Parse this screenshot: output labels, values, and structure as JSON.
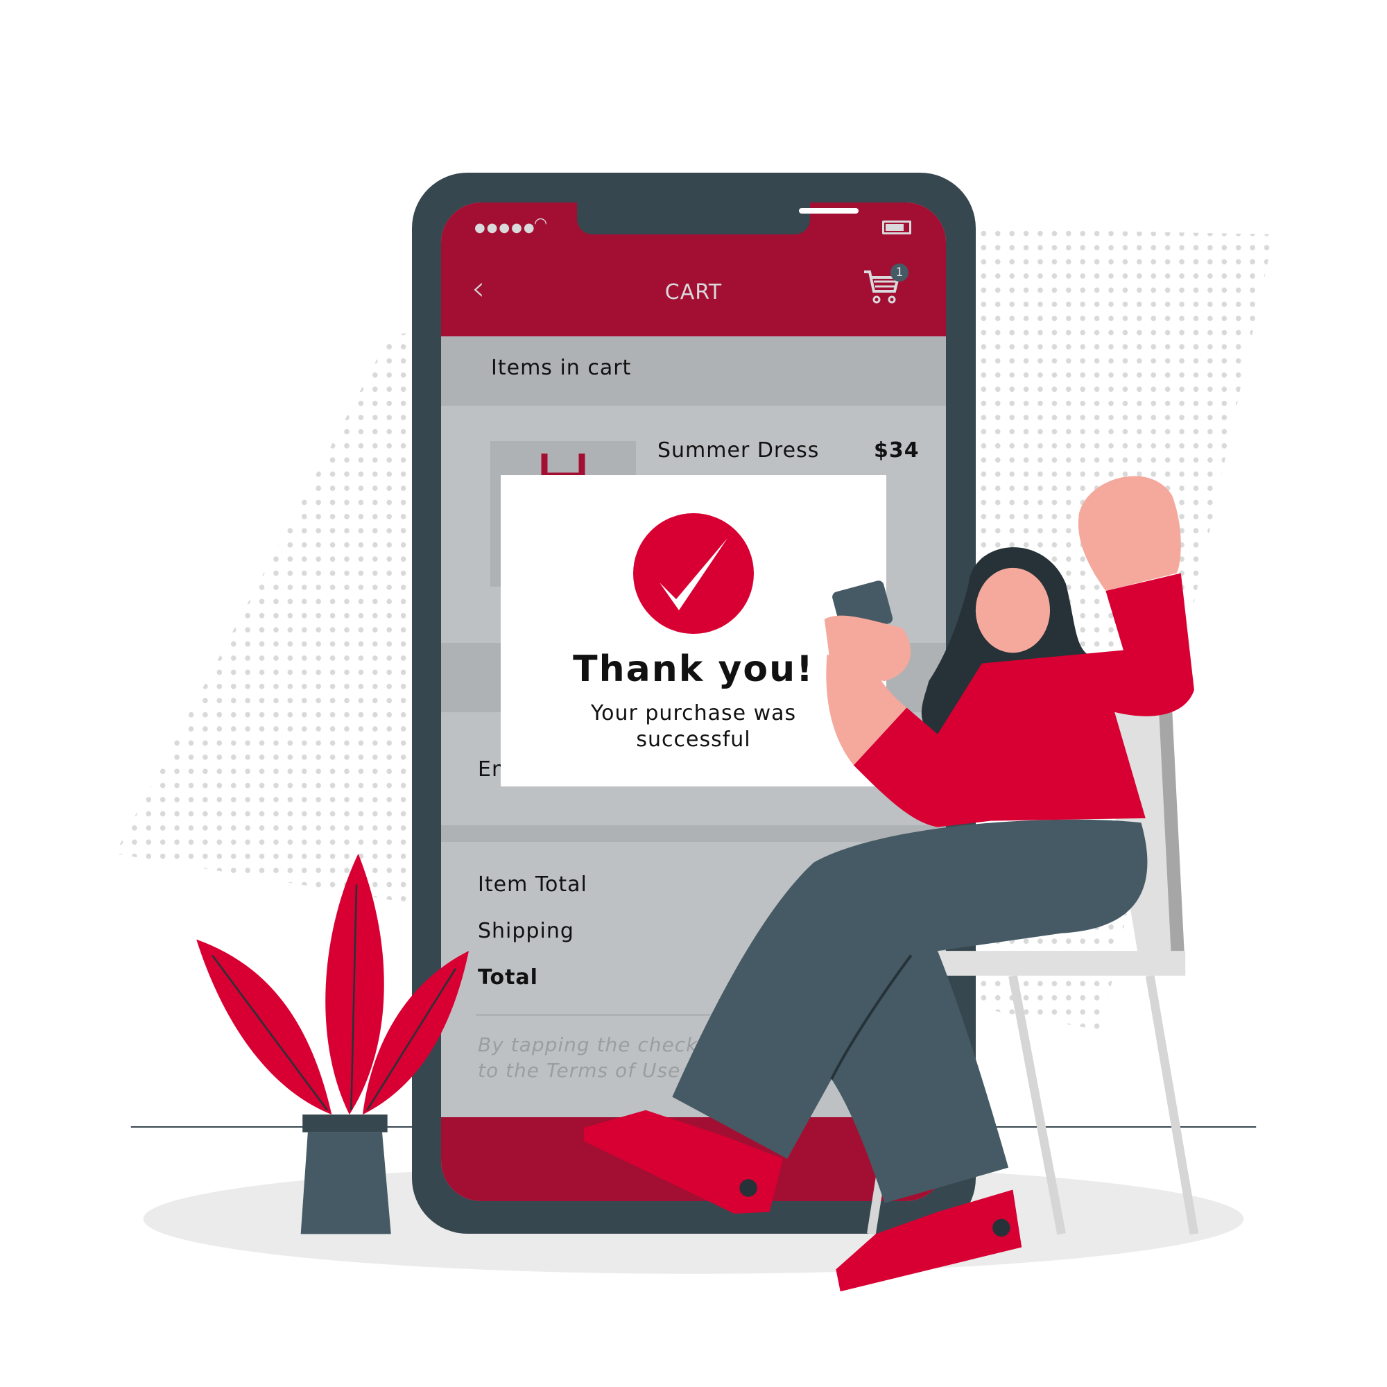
{
  "status_bar": {
    "signal_dots": "●●●●●",
    "wifi_icon": "wifi-icon",
    "battery_icon": "battery-icon"
  },
  "header": {
    "back_glyph": "‹",
    "title": "CART",
    "cart_glyph": "🛒",
    "cart_count": "1"
  },
  "cart": {
    "section_label": "Items in cart",
    "items": [
      {
        "name": "Summer Dress",
        "price": "$34"
      }
    ],
    "partial_label": "En"
  },
  "summary": {
    "item_total_label": "Item Total",
    "shipping_label": "Shipping",
    "total_label": "Total"
  },
  "terms": {
    "line1": "By tapping the checko",
    "line2": "to the Terms of Use"
  },
  "modal": {
    "title": "Thank you!",
    "message_line1": "Your purchase was",
    "message_line2": "successful"
  },
  "colors": {
    "brand_red": "#a30f33",
    "accent_red": "#d80032",
    "phone_frame": "#37474f",
    "screen_gray": "#bec1c4"
  }
}
